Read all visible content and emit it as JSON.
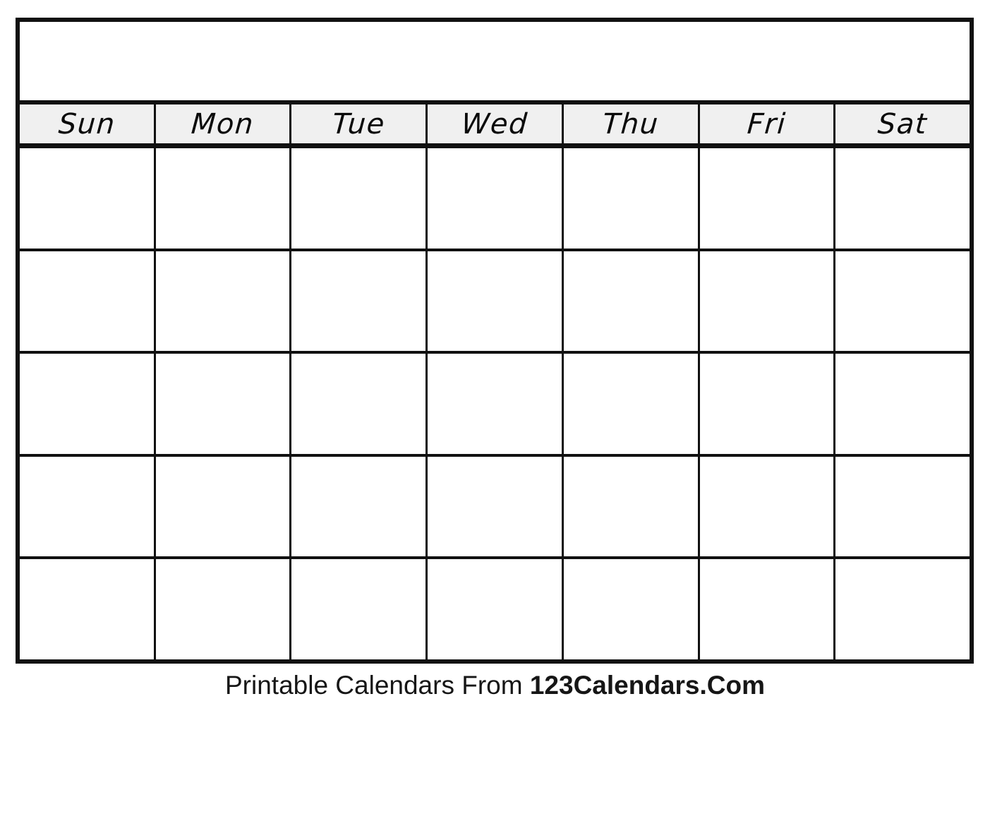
{
  "document": {
    "type": "blank-printable-monthly-calendar",
    "page_background": "#ffffff"
  },
  "calendar": {
    "month_title": "",
    "header": {
      "background_color": "#f0f0f0",
      "text_color": "#0a0a0a",
      "weekdays": [
        {
          "short": "Sun",
          "name": "Sunday"
        },
        {
          "short": "Mon",
          "name": "Monday"
        },
        {
          "short": "Tue",
          "name": "Tuesday"
        },
        {
          "short": "Wed",
          "name": "Wednesday"
        },
        {
          "short": "Thu",
          "name": "Thursday"
        },
        {
          "short": "Fri",
          "name": "Friday"
        },
        {
          "short": "Sat",
          "name": "Saturday"
        }
      ]
    },
    "grid": {
      "columns": 7,
      "rows": 5,
      "border_color": "#111111",
      "cell_background": "#ffffff",
      "weeks": [
        {
          "days": [
            "",
            "",
            "",
            "",
            "",
            "",
            ""
          ]
        },
        {
          "days": [
            "",
            "",
            "",
            "",
            "",
            "",
            ""
          ]
        },
        {
          "days": [
            "",
            "",
            "",
            "",
            "",
            "",
            ""
          ]
        },
        {
          "days": [
            "",
            "",
            "",
            "",
            "",
            "",
            ""
          ]
        },
        {
          "days": [
            "",
            "",
            "",
            "",
            "",
            "",
            ""
          ]
        }
      ]
    }
  },
  "footer": {
    "prefix": "Printable Calendars From ",
    "brand": "123Calendars.Com"
  }
}
